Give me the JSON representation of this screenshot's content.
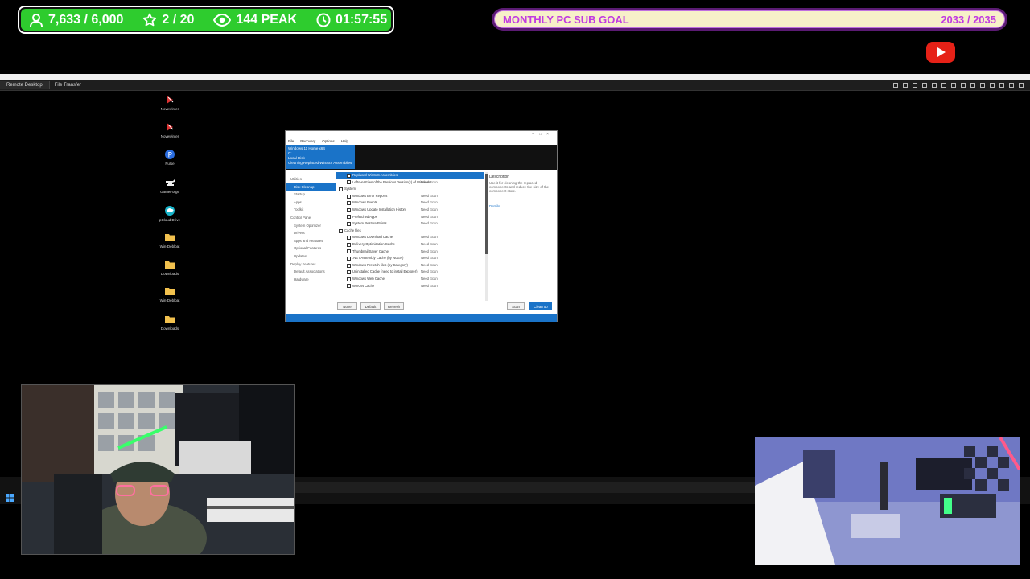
{
  "stats_bar": {
    "followers": "7,633 / 6,000",
    "subs": "2 / 20",
    "viewers": "144 PEAK",
    "uptime": "01:57:55"
  },
  "goal_bar": {
    "label": "MONTHLY PC SUB GOAL",
    "value": "2033 / 2035",
    "progress_fraction": 0.999
  },
  "remote_desktop": {
    "tab_remote": "Remote Desktop",
    "tab_file": "File Transfer"
  },
  "desktop_icons": [
    {
      "label": "Novewinter",
      "icon": "app-icon"
    },
    {
      "label": "Novewinter",
      "icon": "app-icon"
    },
    {
      "label": "Pulse",
      "icon": "p-icon"
    },
    {
      "label": "GameForge",
      "icon": "anvil-icon"
    },
    {
      "label": "pCloud Drive",
      "icon": "cloud-icon"
    },
    {
      "label": "Win-Debloat",
      "icon": "folder-icon"
    },
    {
      "label": "Downloads",
      "icon": "folder-icon"
    },
    {
      "label": "Win-Debloat",
      "icon": "folder-icon"
    },
    {
      "label": "Downloads",
      "icon": "folder-icon"
    }
  ],
  "window": {
    "menu": [
      "File",
      "Recovery",
      "Options",
      "Help"
    ],
    "header_lines": [
      "Windows 11 Home x64",
      "C:",
      "Local Disk",
      "Cleaning Replaced WinSxS Assemblies"
    ],
    "nav": [
      {
        "label": "Utilities",
        "level": 0,
        "active": false
      },
      {
        "label": "Disk Cleanup",
        "level": 1,
        "active": true
      },
      {
        "label": "Startup",
        "level": 1,
        "active": false
      },
      {
        "label": "Apps",
        "level": 1,
        "active": false
      },
      {
        "label": "Toolkit",
        "level": 1,
        "active": false
      },
      {
        "label": "Control Panel",
        "level": 0,
        "active": false
      },
      {
        "label": "System Optimizer",
        "level": 1,
        "active": false
      },
      {
        "label": "Drivers",
        "level": 1,
        "active": false
      },
      {
        "label": "Apps and Features",
        "level": 1,
        "active": false
      },
      {
        "label": "Optional Features",
        "level": 1,
        "active": false
      },
      {
        "label": "Updates",
        "level": 1,
        "active": false
      },
      {
        "label": "Deploy Features",
        "level": 0,
        "active": false
      },
      {
        "label": "Default Associations",
        "level": 1,
        "active": false
      },
      {
        "label": "Hardware",
        "level": 1,
        "active": false
      }
    ],
    "items": [
      {
        "label": "Replaced WinSxS Assemblies",
        "status": "",
        "group": false,
        "selected": true
      },
      {
        "label": "Leftover Files of the Previous Version(s) of Windows",
        "status": "Need Scan",
        "group": false,
        "selected": false
      },
      {
        "label": "System",
        "status": "",
        "group": true,
        "selected": false
      },
      {
        "label": "Windows Error Reports",
        "status": "Need Scan",
        "group": false,
        "selected": false
      },
      {
        "label": "Windows Events",
        "status": "Need Scan",
        "group": false,
        "selected": false
      },
      {
        "label": "Windows Update Installation History",
        "status": "Need Scan",
        "group": false,
        "selected": false
      },
      {
        "label": "Prefetched Apps",
        "status": "Need Scan",
        "group": false,
        "selected": false
      },
      {
        "label": "System Restore Points",
        "status": "Need Scan",
        "group": false,
        "selected": false
      },
      {
        "label": "Cache files",
        "status": "",
        "group": true,
        "selected": false
      },
      {
        "label": "Windows Download Cache",
        "status": "Need Scan",
        "group": false,
        "selected": false
      },
      {
        "label": "Delivery Optimization Cache",
        "status": "Need Scan",
        "group": false,
        "selected": false
      },
      {
        "label": "Thumbnail Saver Cache",
        "status": "Need Scan",
        "group": false,
        "selected": false
      },
      {
        "label": ".NET Assembly Cache (by NGEN)",
        "status": "Need Scan",
        "group": false,
        "selected": false
      },
      {
        "label": "Windows Prefetch files (by Category)",
        "status": "Need Scan",
        "group": false,
        "selected": false
      },
      {
        "label": "Uninstalled Cache (need to install Explorer)",
        "status": "Need Scan",
        "group": false,
        "selected": false
      },
      {
        "label": "Windows Web Cache",
        "status": "Need Scan",
        "group": false,
        "selected": false
      },
      {
        "label": "WinGet Cache",
        "status": "Need Scan",
        "group": false,
        "selected": false
      }
    ],
    "description": {
      "title": "Description",
      "text": "Use it for cleaning the replaced components and reduce the size of the component store.",
      "link": "Details"
    },
    "buttons": {
      "none": "None",
      "default": "Default",
      "refresh": "Refresh",
      "scan": "Scan",
      "cleanup": "Clean up"
    }
  },
  "colors": {
    "stats_green": "#2ecc2e",
    "goal_purple": "#c13be0",
    "app_accent": "#1a73c8"
  }
}
